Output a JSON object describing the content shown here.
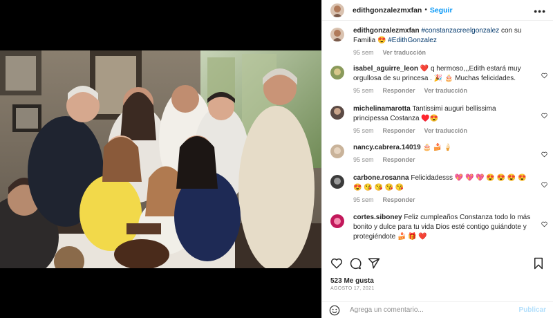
{
  "post": {
    "username": "edithgonzalezmxfan",
    "separator": "•",
    "follow_label": "Seguir",
    "more_label": "•••"
  },
  "caption": {
    "username": "edithgonzalezmxfan",
    "tag1": "#constanzacreelgonzalez",
    "text": " con su Familia 😍 ",
    "tag2": "#EdithGonzalez",
    "time": "95 sem",
    "translate_label": "Ver traducción"
  },
  "comments": [
    {
      "username": "isabel_aguirre_leon",
      "text": "❤️ q hermoso,,,Edith estará muy orgullosa de su princesa . 🎉 🎂 Muchas felicidades.",
      "time": "95 sem",
      "reply": "Responder",
      "translate": "Ver traducción",
      "avatar_color": "#8a9a5b"
    },
    {
      "username": "michelinamarotta",
      "text": "Tantissimi auguri bellissima principessa Costanza ♥️😍",
      "time": "95 sem",
      "reply": "Responder",
      "translate": "Ver traducción",
      "avatar_color": "#5b4a44"
    },
    {
      "username": "nancy.cabrera.14019",
      "text": "🎂 🍰 🍦",
      "time": "95 sem",
      "reply": "Responder",
      "avatar_color": "#c9b39a"
    },
    {
      "username": "carbone.rosanna",
      "text": "Felicidadesss 💖 💖 💖 😍 😍 😍 😍 😍 😘 😘 😘 😘",
      "time": "95 sem",
      "reply": "Responder",
      "avatar_color": "#3b3b3b"
    },
    {
      "username": "cortes.siboney",
      "text": "Feliz cumpleaños Constanza todo lo más bonito y dulce para tu vida Dios esté contigo guiándote y protegiéndote 🍰 🎁 ❤️",
      "avatar_color": "#c2185b"
    }
  ],
  "actions": {
    "like_icon": "heart-icon",
    "comment_icon": "comment-icon",
    "share_icon": "share-icon",
    "save_icon": "bookmark-icon"
  },
  "likes": "523 Me gusta",
  "date": "AGOSTO 17, 2021",
  "add_comment": {
    "placeholder": "Agrega un comentario...",
    "publish_label": "Publicar",
    "emoji_icon": "smiley-icon"
  },
  "colors": {
    "link": "#0095f6",
    "tag": "#00376b",
    "muted": "#8e8e8e",
    "heart": "#ed4956"
  }
}
